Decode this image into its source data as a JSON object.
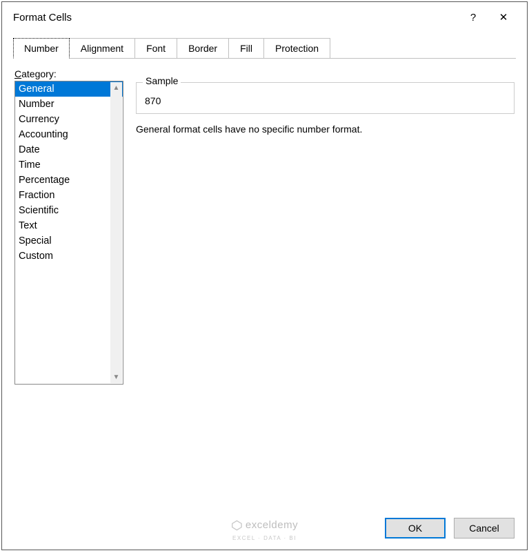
{
  "dialog": {
    "title": "Format Cells",
    "help_symbol": "?",
    "close_symbol": "✕"
  },
  "tabs": [
    "Number",
    "Alignment",
    "Font",
    "Border",
    "Fill",
    "Protection"
  ],
  "active_tab_index": 0,
  "category": {
    "label_pre": "C",
    "label_rest": "ategory:",
    "items": [
      "General",
      "Number",
      "Currency",
      "Accounting",
      "Date",
      "Time",
      "Percentage",
      "Fraction",
      "Scientific",
      "Text",
      "Special",
      "Custom"
    ],
    "selected_index": 0
  },
  "sample": {
    "legend": "Sample",
    "value": "870"
  },
  "description": "General format cells have no specific number format.",
  "footer": {
    "ok": "OK",
    "cancel": "Cancel"
  },
  "watermark": {
    "name": "exceldemy",
    "sub": "EXCEL · DATA · BI"
  }
}
